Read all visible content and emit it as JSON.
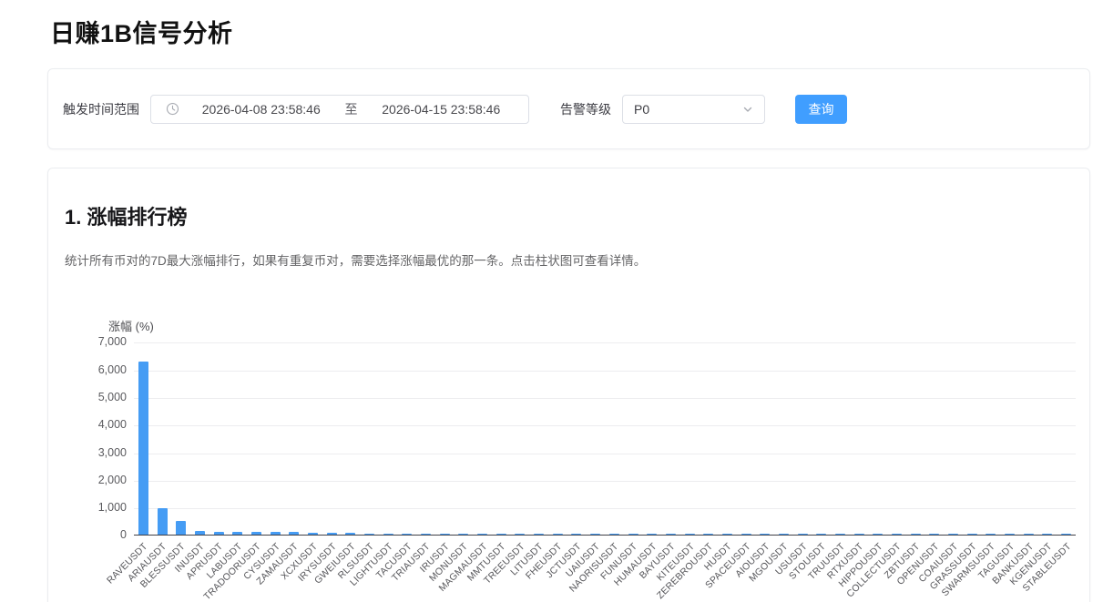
{
  "page": {
    "title": "日赚1B信号分析"
  },
  "filter": {
    "time_range_label": "触发时间范围",
    "start_time": "2026-04-08 23:58:46",
    "range_separator": "至",
    "end_time": "2026-04-15 23:58:46",
    "alert_level_label": "告警等级",
    "alert_level_value": "P0",
    "query_button_label": "查询",
    "icons": {
      "date_picker": "clock-icon",
      "select": "chevron-down-icon"
    }
  },
  "section": {
    "heading": "1. 涨幅排行榜",
    "description": "统计所有币对的7D最大涨幅排行，如果有重复币对，需要选择涨幅最优的那一条。点击柱状图可查看详情。"
  },
  "colors": {
    "accent": "#409EFF",
    "bar": "#459CF4",
    "grid_line": "#ededef",
    "axis_line": "#3f3f46"
  },
  "chart_data": {
    "type": "bar",
    "title": "涨幅 (%)",
    "xlabel": "",
    "ylabel": "涨幅 (%)",
    "ylim": [
      0,
      7000
    ],
    "yticks": [
      0,
      1000,
      2000,
      3000,
      4000,
      5000,
      6000,
      7000
    ],
    "grid": true,
    "legend_position": "none",
    "x_tick_rotation": -45,
    "categories": [
      "RAVEUSDT",
      "ARIAUSDT",
      "BLESSUSDT",
      "INUSDT",
      "APRUSDT",
      "LABUSDT",
      "TRADOORUSDT",
      "CYSUSDT",
      "ZAMAUSDT",
      "XCXUSDT",
      "IRYSUSDT",
      "GWEIUSDT",
      "RLSUSDT",
      "LIGHTUSDT",
      "TACUSDT",
      "TRIAUSDT",
      "IRUSDT",
      "MONUSDT",
      "MAGMAUSDT",
      "MMTUSDT",
      "TREEUSDT",
      "LITUSDT",
      "FHEUSDT",
      "JCTUSDT",
      "UAIUSDT",
      "NAORISUSDT",
      "FUNUSDT",
      "HUMAUSDT",
      "BAYUSDT",
      "KITEUSDT",
      "ZEREBROUSDT",
      "HUSDT",
      "SPACEUSDT",
      "AIOUSDT",
      "MGOUSDT",
      "USUSDT",
      "STOUSDT",
      "TRUUSDT",
      "RTXUSDT",
      "HIPPOUSDT",
      "COLLECTUSDT",
      "ZBTUSDT",
      "OPENUSDT",
      "COAIUSDT",
      "GRASSUSDT",
      "SWARMSUSDT",
      "TAGUSDT",
      "BANKUSDT",
      "KGENUSDT",
      "STABLEUSDT"
    ],
    "values": [
      6300,
      980,
      510,
      160,
      132,
      128,
      118,
      112,
      101,
      92,
      84,
      76,
      66,
      60,
      56,
      52,
      48,
      45,
      42,
      40,
      37,
      35,
      33,
      31,
      29,
      27,
      26,
      25,
      24,
      23,
      22,
      21,
      20,
      19,
      18,
      17,
      16,
      15,
      14,
      13,
      12,
      12,
      11,
      10,
      10,
      9,
      9,
      8,
      8,
      7
    ]
  }
}
